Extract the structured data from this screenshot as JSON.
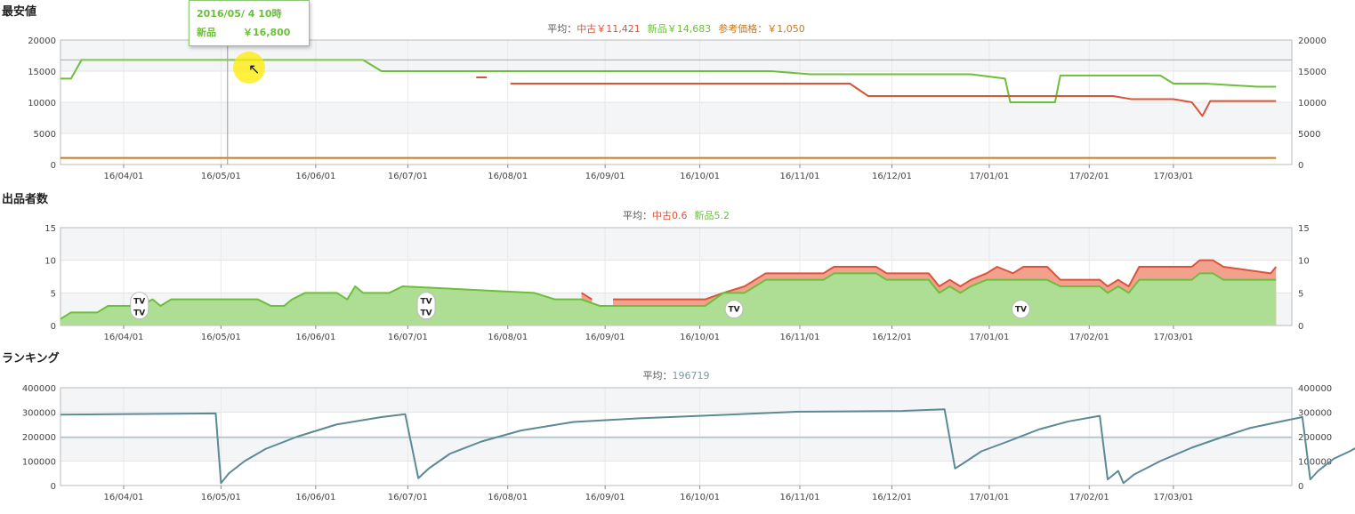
{
  "chart_data": [
    {
      "type": "line",
      "title": "最安値",
      "average": {
        "label": "平均：",
        "used": "中古￥11,421",
        "new": "新品￥14,683",
        "ref": "参考価格：￥1,050"
      },
      "x_ticks": [
        "16/04/01",
        "16/05/01",
        "16/06/01",
        "16/07/01",
        "16/08/01",
        "16/09/01",
        "16/10/01",
        "16/11/01",
        "16/12/01",
        "17/01/01",
        "17/02/01",
        "17/03/01"
      ],
      "ylim": [
        0,
        20000
      ],
      "y_ticks": [
        "20000",
        "15000",
        "10000",
        "5000",
        "0"
      ],
      "series": [
        {
          "name": "新品",
          "color": "#6cbf3a",
          "points": [
            [
              0,
              13800
            ],
            [
              4,
              13800
            ],
            [
              8,
              16800
            ],
            [
              115,
              16800
            ],
            [
              122,
              15000
            ],
            [
              260,
              15000
            ],
            [
              262,
              15000
            ],
            [
              270,
              15000
            ],
            [
              285,
              14500
            ],
            [
              346,
              14500
            ],
            [
              359,
              13800
            ],
            [
              361,
              10000
            ],
            [
              378,
              10000
            ],
            [
              380,
              14300
            ],
            [
              418,
              14300
            ],
            [
              423,
              13000
            ],
            [
              435,
              13000
            ],
            [
              455,
              12500
            ],
            [
              462,
              12500
            ]
          ]
        },
        {
          "name": "中古",
          "color": "#d9553a",
          "points": [
            [
              158,
              14000
            ],
            [
              162,
              14000
            ],
            null,
            [
              171,
              13000
            ],
            [
              260,
              13000
            ],
            [
              270,
              13000
            ],
            [
              300,
              13000
            ],
            [
              307,
              11000
            ],
            [
              347,
              11000
            ],
            [
              375,
              11000
            ],
            [
              380,
              11000
            ],
            [
              400,
              11000
            ],
            [
              407,
              10500
            ],
            [
              423,
              10500
            ],
            [
              430,
              10000
            ],
            [
              434,
              7800
            ],
            [
              437,
              10200
            ],
            [
              462,
              10200
            ]
          ]
        },
        {
          "name": "参考価格",
          "color": "#c8791e",
          "points": [
            [
              0,
              1050
            ],
            [
              462,
              1050
            ]
          ]
        }
      ],
      "hover": {
        "date": "2016/05/ 4 10時",
        "label": "新品",
        "value": "￥16,800"
      }
    },
    {
      "type": "area",
      "title": "出品者数",
      "average": {
        "label": "平均：",
        "used": "中古0.6",
        "new": "新品5.2"
      },
      "x_ticks": [
        "16/04/01",
        "16/05/01",
        "16/06/01",
        "16/07/01",
        "16/08/01",
        "16/09/01",
        "16/10/01",
        "16/11/01",
        "16/12/01",
        "17/01/01",
        "17/02/01",
        "17/03/01"
      ],
      "ylim": [
        0,
        15
      ],
      "y_ticks": [
        "15",
        "10",
        "5",
        "0"
      ],
      "series": [
        {
          "name": "新品",
          "color": "#6cbf3a",
          "points": [
            [
              0,
              1
            ],
            [
              4,
              2
            ],
            [
              14,
              2
            ],
            [
              18,
              3
            ],
            [
              26,
              3
            ],
            [
              30,
              3
            ],
            [
              35,
              4
            ],
            [
              38,
              3
            ],
            [
              42,
              4
            ],
            [
              75,
              4
            ],
            [
              80,
              3
            ],
            [
              85,
              3
            ],
            [
              88,
              4
            ],
            [
              93,
              5
            ],
            [
              105,
              5
            ],
            [
              109,
              4
            ],
            [
              112,
              6
            ],
            [
              115,
              5
            ],
            [
              125,
              5
            ],
            [
              130,
              6
            ],
            [
              180,
              5
            ],
            [
              188,
              4
            ],
            [
              198,
              4
            ],
            [
              205,
              3
            ],
            [
              215,
              3
            ],
            [
              245,
              3
            ],
            [
              252,
              5
            ],
            [
              260,
              5
            ],
            [
              264,
              6
            ],
            [
              268,
              7
            ],
            [
              290,
              7
            ],
            [
              294,
              8
            ],
            [
              310,
              8
            ],
            [
              314,
              7
            ],
            [
              330,
              7
            ],
            [
              334,
              5
            ],
            [
              338,
              6
            ],
            [
              342,
              5
            ],
            [
              346,
              6
            ],
            [
              352,
              7
            ],
            [
              375,
              7
            ],
            [
              380,
              6
            ],
            [
              395,
              6
            ],
            [
              398,
              5
            ],
            [
              402,
              6
            ],
            [
              406,
              5
            ],
            [
              410,
              7
            ],
            [
              430,
              7
            ],
            [
              433,
              8
            ],
            [
              438,
              8
            ],
            [
              442,
              7
            ],
            [
              460,
              7
            ],
            [
              462,
              7
            ]
          ]
        },
        {
          "name": "中古",
          "color": "#d9553a",
          "points": [
            [
              198,
              5
            ],
            [
              202,
              4
            ],
            null,
            [
              210,
              4
            ],
            [
              245,
              4
            ],
            [
              252,
              5
            ],
            [
              260,
              6
            ],
            [
              264,
              7
            ],
            [
              268,
              8
            ],
            [
              290,
              8
            ],
            [
              294,
              9
            ],
            [
              310,
              9
            ],
            [
              314,
              8
            ],
            [
              330,
              8
            ],
            [
              334,
              6
            ],
            [
              338,
              7
            ],
            [
              342,
              6
            ],
            [
              346,
              7
            ],
            [
              352,
              8
            ],
            [
              356,
              9
            ],
            [
              362,
              8
            ],
            [
              366,
              9
            ],
            [
              375,
              9
            ],
            [
              380,
              7
            ],
            [
              395,
              7
            ],
            [
              398,
              6
            ],
            [
              402,
              7
            ],
            [
              406,
              6
            ],
            [
              410,
              9
            ],
            [
              430,
              9
            ],
            [
              433,
              10
            ],
            [
              438,
              10
            ],
            [
              442,
              9
            ],
            [
              460,
              8
            ],
            [
              462,
              9
            ]
          ]
        }
      ],
      "tv_markers": [
        {
          "label": "TV",
          "x": 30,
          "value": 2.5,
          "double": true
        },
        {
          "label": "TV",
          "x": 139,
          "value": 2.5,
          "double": true
        },
        {
          "label": "TV",
          "x": 256,
          "value": 2.5,
          "double": false
        },
        {
          "label": "TV",
          "x": 365,
          "value": 2.5,
          "double": false
        }
      ]
    },
    {
      "type": "line",
      "title": "ランキング",
      "average": {
        "label": "平均：",
        "value": "196719"
      },
      "x_ticks": [
        "16/04/01",
        "16/05/01",
        "16/06/01",
        "16/07/01",
        "16/08/01",
        "16/09/01",
        "16/10/01",
        "16/11/01",
        "16/12/01",
        "17/01/01",
        "17/02/01",
        "17/03/01"
      ],
      "ylim": [
        0,
        400000
      ],
      "y_ticks": [
        "400000",
        "300000",
        "200000",
        "100000",
        "0"
      ],
      "average_line": 196719,
      "series": [
        {
          "name": "ランキング",
          "color": "#5b8a96",
          "points": [
            [
              0,
              290000
            ],
            [
              59,
              295000
            ],
            [
              61,
              10000
            ],
            [
              64,
              50000
            ],
            [
              70,
              100000
            ],
            [
              78,
              150000
            ],
            [
              90,
              200000
            ],
            [
              105,
              250000
            ],
            [
              122,
              280000
            ],
            [
              131,
              292000
            ],
            [
              136,
              30000
            ],
            [
              140,
              70000
            ],
            [
              148,
              130000
            ],
            [
              160,
              180000
            ],
            [
              175,
              225000
            ],
            [
              195,
              260000
            ],
            [
              220,
              275000
            ],
            [
              250,
              288000
            ],
            [
              280,
              302000
            ],
            [
              320,
              305000
            ],
            [
              336,
              312000
            ],
            [
              340,
              70000
            ],
            [
              343,
              90000
            ],
            [
              350,
              140000
            ],
            [
              360,
              180000
            ],
            [
              372,
              230000
            ],
            [
              383,
              262000
            ],
            [
              395,
              285000
            ],
            [
              398,
              25000
            ],
            [
              402,
              60000
            ],
            [
              404,
              10000
            ],
            [
              408,
              45000
            ],
            [
              418,
              100000
            ],
            [
              430,
              155000
            ],
            [
              442,
              200000
            ],
            [
              452,
              235000
            ],
            [
              463,
              260000
            ],
            [
              472,
              280000
            ],
            [
              475,
              25000
            ],
            [
              478,
              60000
            ],
            [
              484,
              110000
            ],
            [
              490,
              140000
            ],
            [
              495,
              170000
            ]
          ]
        }
      ]
    }
  ]
}
